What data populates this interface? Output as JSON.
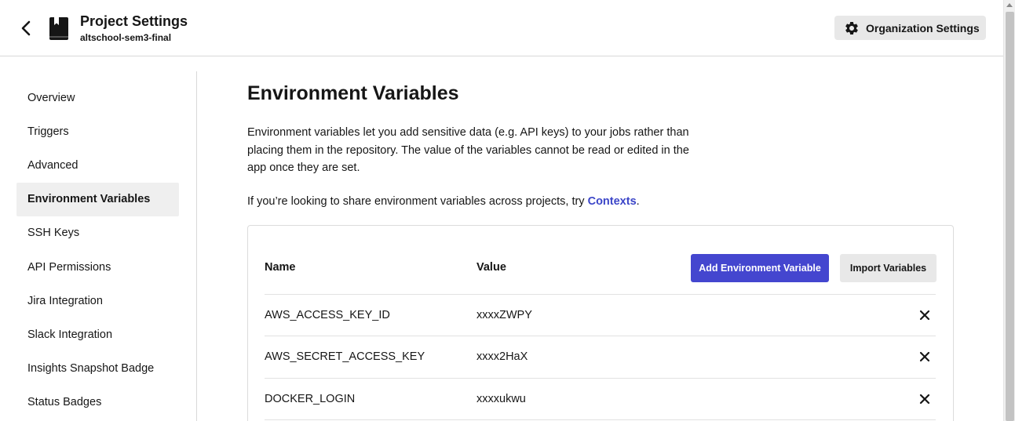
{
  "header": {
    "title": "Project Settings",
    "subtitle": "altschool-sem3-final",
    "back_icon": "chevron-left-icon",
    "project_icon": "bookmark-icon",
    "org_button": {
      "label": "Organization Settings",
      "icon": "gear-icon"
    }
  },
  "sidebar": {
    "items": [
      {
        "label": "Overview",
        "active": false
      },
      {
        "label": "Triggers",
        "active": false
      },
      {
        "label": "Advanced",
        "active": false
      },
      {
        "label": "Environment Variables",
        "active": true
      },
      {
        "label": "SSH Keys",
        "active": false
      },
      {
        "label": "API Permissions",
        "active": false
      },
      {
        "label": "Jira Integration",
        "active": false
      },
      {
        "label": "Slack Integration",
        "active": false
      },
      {
        "label": "Insights Snapshot Badge",
        "active": false
      },
      {
        "label": "Status Badges",
        "active": false
      }
    ]
  },
  "main": {
    "title": "Environment Variables",
    "description": "Environment variables let you add sensitive data (e.g. API keys) to your jobs rather than placing them in the repository. The value of the variables cannot be read or edited in the app once they are set.",
    "share_text": "If you’re looking to share environment variables across projects, try ",
    "share_link": "Contexts",
    "share_suffix": ".",
    "table": {
      "col_name": "Name",
      "col_value": "Value",
      "add_button": "Add Environment Variable",
      "import_button": "Import Variables",
      "rows": [
        {
          "name": "AWS_ACCESS_KEY_ID",
          "value": "xxxxZWPY"
        },
        {
          "name": "AWS_SECRET_ACCESS_KEY",
          "value": "xxxx2HaX"
        },
        {
          "name": "DOCKER_LOGIN",
          "value": "xxxxukwu"
        }
      ]
    }
  },
  "colors": {
    "accent": "#4446cf",
    "link": "#3b45c8",
    "active_nav_bg": "#efefef",
    "secondary_button_bg": "#e8e8e8"
  }
}
